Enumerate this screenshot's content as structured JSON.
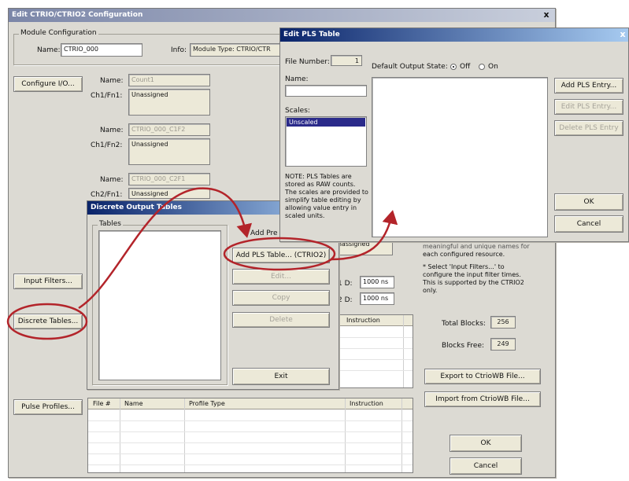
{
  "main": {
    "title": "Edit CTRIO/CTRIO2 Configuration",
    "module_group_label": "Module Configuration",
    "name_label": "Name:",
    "name_value": "CTRIO_000",
    "info_label": "Info:",
    "info_value": "Module Type: CTRIO/CTR",
    "configure_io": "Configure I/O...",
    "input_filters": "Input Filters...",
    "discrete_tables": "Discrete Tables...",
    "pulse_profiles": "Pulse Profiles...",
    "fn_name_label": "Name:",
    "ch1fn1_label": "Ch1/Fn1:",
    "ch1fn1_name": "Count1",
    "ch1fn1_value": "Unassigned",
    "ch1fn2_label": "Ch1/Fn2:",
    "ch1fn2_name": "CTRIO_000_C1F2",
    "ch1fn2_value": "Unassigned",
    "ch2fn1_label": "Ch2/Fn1:",
    "ch2fn1_name": "CTRIO_000_C2F1",
    "ch2fn1_value": "Unassigned",
    "unassigned_partial": "Unassigned",
    "filter1_label": "1 D:",
    "filter1_value": "1000 ns",
    "filter2_label": "2 D:",
    "filter2_value": "1000 ns",
    "help_lines": [
      "* Select 'Input Filters...' to",
      "configure the input filter times.",
      "This is supported by the CTRIO2",
      "only."
    ],
    "help_partial_line1": "meaningful and unique names for",
    "help_partial_line2": "each configured resource.",
    "total_blocks_label": "Total Blocks:",
    "total_blocks_value": "256",
    "blocks_free_label": "Blocks Free:",
    "blocks_free_value": "249",
    "export_btn": "Export to CtrioWB File...",
    "import_btn": "Import from CtrioWB File...",
    "ok": "OK",
    "cancel": "Cancel",
    "close": "x",
    "grid_headers": [
      "File #",
      "Name",
      "Profile Type",
      "Instruction"
    ],
    "instruction_header": "Instruction"
  },
  "discrete": {
    "title": "Discrete Output Tables",
    "tables_label": "Tables",
    "add_pres_partial": "Add Pre",
    "add_pls_btn": "Add PLS Table... (CTRIO2)",
    "edit_btn": "Edit...",
    "copy_btn": "Copy",
    "delete_btn": "Delete",
    "exit_btn": "Exit"
  },
  "pls": {
    "title": "Edit PLS Table",
    "close": "x",
    "file_number_label": "File Number:",
    "file_number_value": "1",
    "name_label": "Name:",
    "scales_label": "Scales:",
    "scales_selected": "Unscaled",
    "default_output_label": "Default Output State:",
    "off_label": "Off",
    "on_label": "On",
    "note": "NOTE: PLS Tables are stored as RAW counts. The scales are provided to simplify table editing by allowing value entry in scaled units.",
    "add_entry": "Add PLS Entry...",
    "edit_entry": "Edit PLS Entry...",
    "delete_entry": "Delete PLS Entry",
    "ok": "OK",
    "cancel": "Cancel"
  },
  "colors": {
    "title_active": "#0a246a",
    "window_face": "#dcdad3",
    "highlight_circle": "#b3242a",
    "selection": "#2a2a8a"
  }
}
